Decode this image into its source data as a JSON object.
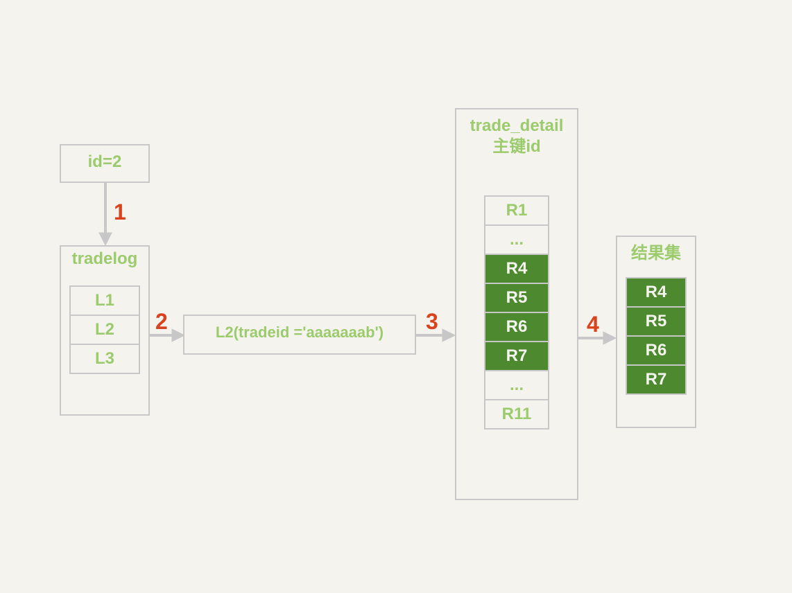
{
  "steps": {
    "s1": "1",
    "s2": "2",
    "s3": "3",
    "s4": "4"
  },
  "id_box": {
    "label": "id=2"
  },
  "tradelog": {
    "title": "tradelog",
    "rows": [
      "L1",
      "L2",
      "L3"
    ]
  },
  "lookup": {
    "text": "L2(tradeid ='aaaaaaab')"
  },
  "trade_detail": {
    "title_line1": "trade_detail",
    "title_line2": "主键id",
    "rows": [
      {
        "label": "R1",
        "hit": false
      },
      {
        "label": "...",
        "hit": false
      },
      {
        "label": "R4",
        "hit": true
      },
      {
        "label": "R5",
        "hit": true
      },
      {
        "label": "R6",
        "hit": true
      },
      {
        "label": "R7",
        "hit": true
      },
      {
        "label": "...",
        "hit": false
      },
      {
        "label": "R11",
        "hit": false
      }
    ]
  },
  "result": {
    "title": "结果集",
    "rows": [
      "R4",
      "R5",
      "R6",
      "R7"
    ]
  }
}
